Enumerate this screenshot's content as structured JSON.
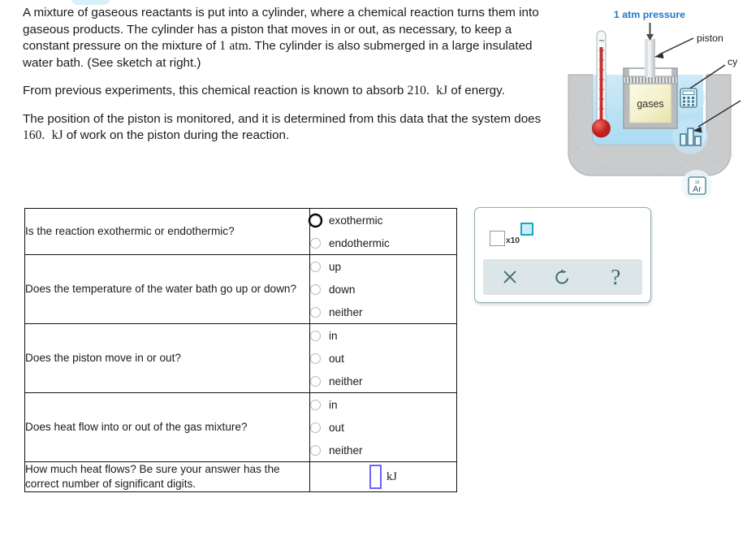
{
  "statement": {
    "paragraph_1_a": "A mixture of gaseous reactants is put into a cylinder, where a chemical reaction turns them into gaseous products. The cylinder has a piston that moves in or out, as necessary, to keep a constant pressure on the mixture of ",
    "paragraph_1_pressure": "1",
    "paragraph_1_pressure_unit": "atm.",
    "paragraph_1_b": " The cylinder is also submerged in a large insulated water bath. (See sketch at right.)",
    "paragraph_2_a": "From previous experiments, this chemical reaction is known to absorb ",
    "paragraph_2_value": "210.",
    "paragraph_2_unit": "kJ",
    "paragraph_2_b": " of energy.",
    "paragraph_3_a": "The position of the piston is monitored, and it is determined from this data that the system does ",
    "paragraph_3_value": "160.",
    "paragraph_3_unit": "kJ",
    "paragraph_3_b": " of work on the piston during the reaction."
  },
  "sketch": {
    "pressure_label": "1 atm pressure",
    "piston_label": "piston",
    "cylinder_label": "cy",
    "gases_label": "gases",
    "element_number": "18",
    "element_symbol": "Ar",
    "colors": {
      "label_blue": "#2277cc",
      "water_blue": "#bfe4f5",
      "container_gray": "#c9cbcc",
      "gas_yellow": "#f2efc9",
      "thermometer_red": "#d12a26"
    }
  },
  "table": {
    "rows": [
      {
        "question": "Is the reaction exothermic or endothermic?",
        "type": "radio",
        "options": [
          {
            "label": "exothermic",
            "focused": true
          },
          {
            "label": "endothermic",
            "focused": false
          }
        ]
      },
      {
        "question": "Does the temperature of the water bath go up or down?",
        "type": "radio",
        "options": [
          {
            "label": "up",
            "focused": false
          },
          {
            "label": "down",
            "focused": false
          },
          {
            "label": "neither",
            "focused": false
          }
        ]
      },
      {
        "question": "Does the piston move in or out?",
        "type": "radio",
        "options": [
          {
            "label": "in",
            "focused": false
          },
          {
            "label": "out",
            "focused": false
          },
          {
            "label": "neither",
            "focused": false
          }
        ]
      },
      {
        "question": "Does heat flow into or out of the gas mixture?",
        "type": "radio",
        "options": [
          {
            "label": "in",
            "focused": false
          },
          {
            "label": "out",
            "focused": false
          },
          {
            "label": "neither",
            "focused": false
          }
        ]
      },
      {
        "question": "How much heat flows? Be sure your answer has the correct number of significant digits.",
        "type": "numeric",
        "value": "",
        "unit": "kJ"
      }
    ]
  },
  "toolbar": {
    "sci_notation_label": "x10",
    "clear_label": "clear-icon",
    "undo_label": "undo-icon",
    "help_label": "?",
    "accent_teal": "#1ba7c4",
    "footer_bg": "#dce5e7"
  }
}
